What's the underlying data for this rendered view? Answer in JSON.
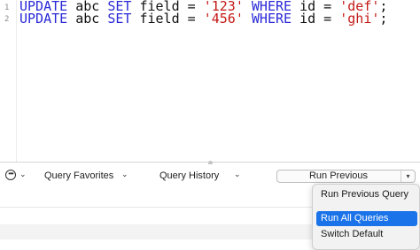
{
  "editor": {
    "line_numbers": [
      "1",
      "2"
    ],
    "lines": [
      {
        "k1": "UPDATE",
        "t1": " abc ",
        "k2": "SET",
        "t2": " field = ",
        "s1": "'123'",
        "t3": " ",
        "k3": "WHERE",
        "t4": " id = ",
        "s2": "'def'",
        "t5": ";"
      },
      {
        "k1": "UPDATE",
        "t1": " abc ",
        "k2": "SET",
        "t2": " field = ",
        "s1": "'456'",
        "t3": " ",
        "k3": "WHERE",
        "t4": " id = ",
        "s2": "'ghi'",
        "t5": ";"
      }
    ]
  },
  "toolbar": {
    "actions_icon": "ellipsis-circle-icon",
    "query_favorites": "Query Favorites",
    "query_history": "Query History",
    "run_button": "Run Previous"
  },
  "run_menu": {
    "items": [
      {
        "label": "Run Previous Query",
        "selected": false
      },
      {
        "label": "Run All Queries",
        "selected": true
      },
      {
        "label": "Switch Default",
        "selected": false
      }
    ]
  },
  "colors": {
    "keyword": "#2a2ad8",
    "string": "#c41a16",
    "selection": "#1a73e8"
  }
}
